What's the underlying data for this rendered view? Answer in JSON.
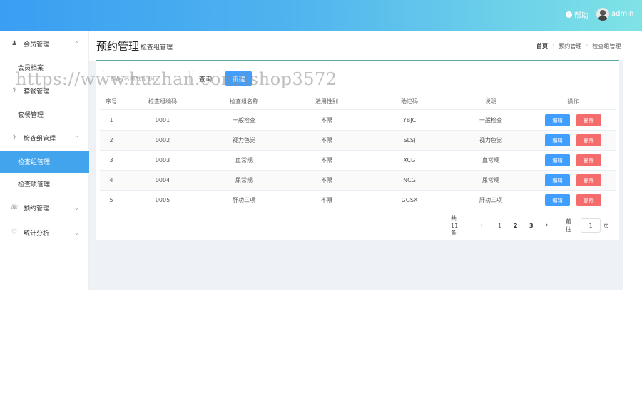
{
  "header": {
    "help_label": "帮助",
    "user_name": "admin"
  },
  "sidebar": {
    "groups": [
      {
        "label": "会员管理",
        "icon": "member-icon"
      },
      {
        "label": "套餐管理",
        "icon": "stethoscope-icon"
      },
      {
        "label": "检查组管理",
        "icon": "stethoscope-icon"
      },
      {
        "label": "预约管理",
        "icon": "appointment-icon"
      },
      {
        "label": "统计分析",
        "icon": "heart-chart-icon"
      }
    ],
    "items": [
      {
        "label": "会员档案"
      },
      {
        "label": "套餐管理"
      },
      {
        "label": "检查组管理",
        "active": true
      },
      {
        "label": "检查项管理"
      }
    ]
  },
  "page": {
    "title": "预约管理",
    "subtitle": "检查组管理",
    "breadcrumb": [
      "首页",
      "预约管理",
      "检查组管理"
    ]
  },
  "toolbar": {
    "search_placeholder": "编码/名称/助记码",
    "query_label": "查询",
    "add_label": "新建"
  },
  "table": {
    "columns": [
      "序号",
      "检查组编码",
      "检查组名称",
      "适用性别",
      "助记码",
      "说明",
      "操作"
    ],
    "rows": [
      {
        "index": "1",
        "code": "0001",
        "name": "一般检查",
        "sex": "不限",
        "helpcode": "YBJC",
        "remark": "一般检查"
      },
      {
        "index": "2",
        "code": "0002",
        "name": "视力色觉",
        "sex": "不限",
        "helpcode": "SLSJ",
        "remark": "视力色觉"
      },
      {
        "index": "3",
        "code": "0003",
        "name": "血常规",
        "sex": "不限",
        "helpcode": "XCG",
        "remark": "血常规"
      },
      {
        "index": "4",
        "code": "0004",
        "name": "尿常规",
        "sex": "不限",
        "helpcode": "NCG",
        "remark": "尿常规"
      },
      {
        "index": "5",
        "code": "0005",
        "name": "肝功三项",
        "sex": "不限",
        "helpcode": "GGSX",
        "remark": "肝功三项"
      }
    ],
    "edit_label": "编辑",
    "delete_label": "删除"
  },
  "pagination": {
    "total_text": "共 11 条",
    "pages": [
      "1",
      "2",
      "3"
    ],
    "goto_label": "前往",
    "goto_value": "1",
    "unit_label": "页"
  },
  "watermark": "https://www.huzhan.com/ishop3572",
  "colors": {
    "primary": "#409eff",
    "danger": "#f56c6c",
    "active_menu": "#43a4ee",
    "header_start": "#3a9ef2",
    "header_end": "#7fe3e6"
  }
}
